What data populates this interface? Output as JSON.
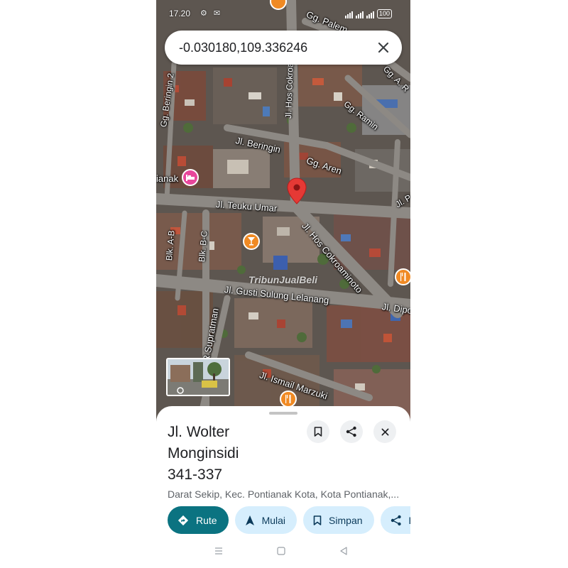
{
  "status_bar": {
    "time": "17.20",
    "system_icons": "⚙ ✉",
    "battery": "100"
  },
  "search": {
    "query": "-0.030180,109.336246"
  },
  "map": {
    "streets": [
      "Gg. Palem",
      "Jl. Hos Cokroaminoto",
      "Gg. Beringin 2",
      "Gg. Ramin",
      "Jl. Beringin",
      "Gg. Aren",
      "Jl. Teuku Umar",
      "Jl. Hos Cokroaminoto",
      "Blk. A-B",
      "Blk. B-C",
      "Jl. Gusti Sulung Lelanang",
      "Jl. Dipo",
      "R Supratman",
      "Jl. Ismail Marzuki",
      "ianak",
      "Gg. A. R",
      "Jl. P"
    ],
    "watermark": "TribunJualBeli"
  },
  "place": {
    "title_lines": [
      "Jl. Wolter",
      "Monginsidi",
      "341-337"
    ],
    "address": "Darat Sekip, Kec. Pontianak Kota, Kota Pontianak,..."
  },
  "actions": {
    "route": "Rute",
    "start": "Mulai",
    "save": "Simpan",
    "share": "B"
  },
  "colors": {
    "primary": "#0b7381",
    "chip_bg": "#d6eefd",
    "pin": "#e53935",
    "poi_orange": "#f08a24",
    "poi_pink": "#e8479b"
  }
}
